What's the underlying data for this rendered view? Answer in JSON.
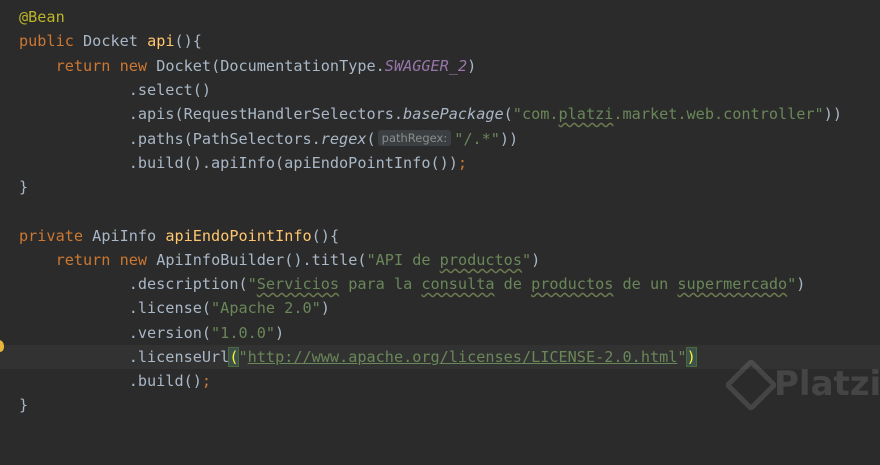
{
  "code": {
    "annotation": "@Bean",
    "kw_public": "public",
    "type_docket": "Docket",
    "fn_api": "api",
    "paren_brace": "(){",
    "kw_return": "return",
    "kw_new": "new",
    "docket_call_open": "Docket(DocumentationType.",
    "swagger_const": "SWAGGER_2",
    "close_paren": ")",
    "select_call": ".select()",
    "apis_open": ".apis(RequestHandlerSelectors.",
    "base_package": "basePackage",
    "apis_str_q1": "\"com.",
    "apis_str_platzi": "platzi",
    "apis_str_rest": ".market.web.controller\"",
    "double_close": "))",
    "paths_open": ".paths(PathSelectors.",
    "regex": "regex",
    "open_paren": "(",
    "param_hint": "pathRegex:",
    "paths_str": "\"/.*\"",
    "build_apiinfo": ".build().apiInfo(apiEndoPointInfo())",
    "semicolon": ";",
    "close_brace": "}",
    "kw_private": "private",
    "type_apiinfo": "ApiInfo",
    "fn_endpoint": "apiEndoPointInfo",
    "builder_open": "ApiInfoBuilder().title(",
    "title_str_q": "\"API de ",
    "title_str_word": "productos",
    "title_str_end": "\"",
    "desc_open": ".description(",
    "desc_q": "\"",
    "desc_w1": "Servicios",
    "desc_s1": " para la ",
    "desc_w2": "consulta",
    "desc_s2": " de ",
    "desc_w3": "productos",
    "desc_s3": " de un ",
    "desc_w4": "supermercado",
    "license_open": ".license(",
    "license_str": "\"Apache 2.0\"",
    "version_open": ".version(",
    "version_str": "\"1.0.0\"",
    "licenseurl_open": ".licenseUrl",
    "licenseurl_str_q": "\"",
    "licenseurl_url": "http://www.apache.org/licenses/LICENSE-2.0.html",
    "build_call": ".build()"
  },
  "watermark": {
    "text": "Platzi"
  },
  "colors": {
    "background": "#2b2b2b",
    "keyword": "#cc7832",
    "function": "#ffc66d",
    "string": "#6a8759",
    "constant": "#9876aa",
    "annotation": "#bbb529",
    "text": "#a9b7c6"
  }
}
